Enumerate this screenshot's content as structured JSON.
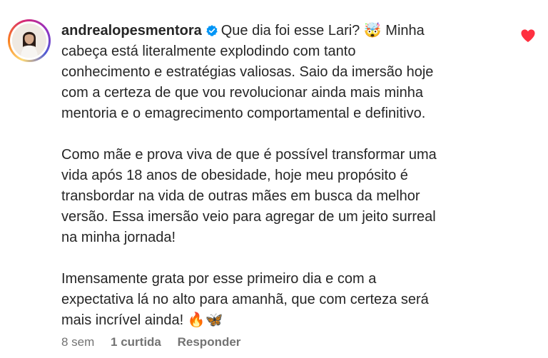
{
  "comment": {
    "username": "andrealopesmentora",
    "lines": [
      "Que dia foi esse Lari? 🤯 Minha",
      "cabeça está literalmente explodindo com tanto",
      "conhecimento e estratégias valiosas. Saio da imersão hoje",
      "com a certeza de que vou revolucionar ainda mais minha",
      "mentoria e o emagrecimento comportamental e definitivo."
    ],
    "paragraph2": [
      "Como mãe e prova viva de que é possível transformar uma",
      "vida após 18 anos de obesidade, hoje meu propósito é",
      "transbordar na vida de outras mães em busca da melhor",
      "versão. Essa imersão veio para agregar de um jeito surreal",
      "na minha jornada!"
    ],
    "paragraph3": [
      "Imensamente grata por esse primeiro dia e com a",
      "expectativa lá no alto para amanhã, que com certeza será",
      "mais incrível ainda! 🔥🦋"
    ],
    "time": "8 sem",
    "likes": "1 curtida",
    "reply_label": "Responder"
  },
  "icons": {
    "verified": "verified-badge-icon",
    "like": "heart-icon"
  },
  "colors": {
    "verified": "#0095f6",
    "heart": "#ff3040",
    "meta_text": "#737373",
    "text": "#262626"
  }
}
